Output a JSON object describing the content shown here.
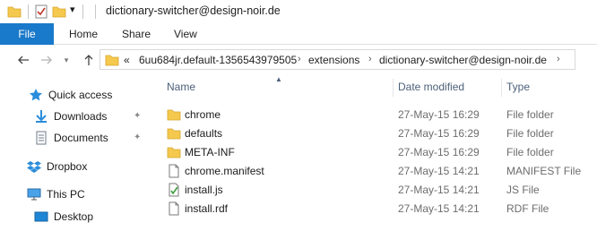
{
  "window": {
    "title": "dictionary-switcher@design-noir.de"
  },
  "ribbon": {
    "file_label": "File",
    "tabs": [
      "Home",
      "Share",
      "View"
    ]
  },
  "address": {
    "overflow": "«",
    "crumbs": [
      "6uu684jr.default-1356543979505",
      "extensions",
      "dictionary-switcher@design-noir.de"
    ]
  },
  "nav": {
    "items": [
      {
        "label": "Quick access",
        "icon": "star-icon"
      },
      {
        "label": "Downloads",
        "icon": "download-icon",
        "pinned": true
      },
      {
        "label": "Documents",
        "icon": "documents-icon",
        "pinned": true
      },
      {
        "label": "Dropbox",
        "icon": "dropbox-icon"
      },
      {
        "label": "This PC",
        "icon": "computer-icon"
      },
      {
        "label": "Desktop",
        "icon": "desktop-icon"
      }
    ]
  },
  "columns": {
    "name": "Name",
    "date": "Date modified",
    "type": "Type"
  },
  "files": [
    {
      "name": "chrome",
      "date": "27-May-15 16:29",
      "type": "File folder",
      "icon": "folder-icon"
    },
    {
      "name": "defaults",
      "date": "27-May-15 16:29",
      "type": "File folder",
      "icon": "folder-icon"
    },
    {
      "name": "META-INF",
      "date": "27-May-15 16:29",
      "type": "File folder",
      "icon": "folder-icon"
    },
    {
      "name": "chrome.manifest",
      "date": "27-May-15 14:21",
      "type": "MANIFEST File",
      "icon": "file-icon"
    },
    {
      "name": "install.js",
      "date": "27-May-15 14:21",
      "type": "JS File",
      "icon": "script-file-icon"
    },
    {
      "name": "install.rdf",
      "date": "27-May-15 14:21",
      "type": "RDF File",
      "icon": "file-icon"
    }
  ],
  "colors": {
    "accent": "#1979ca",
    "folder": "#f5c94d",
    "header_text": "#4c607a"
  }
}
